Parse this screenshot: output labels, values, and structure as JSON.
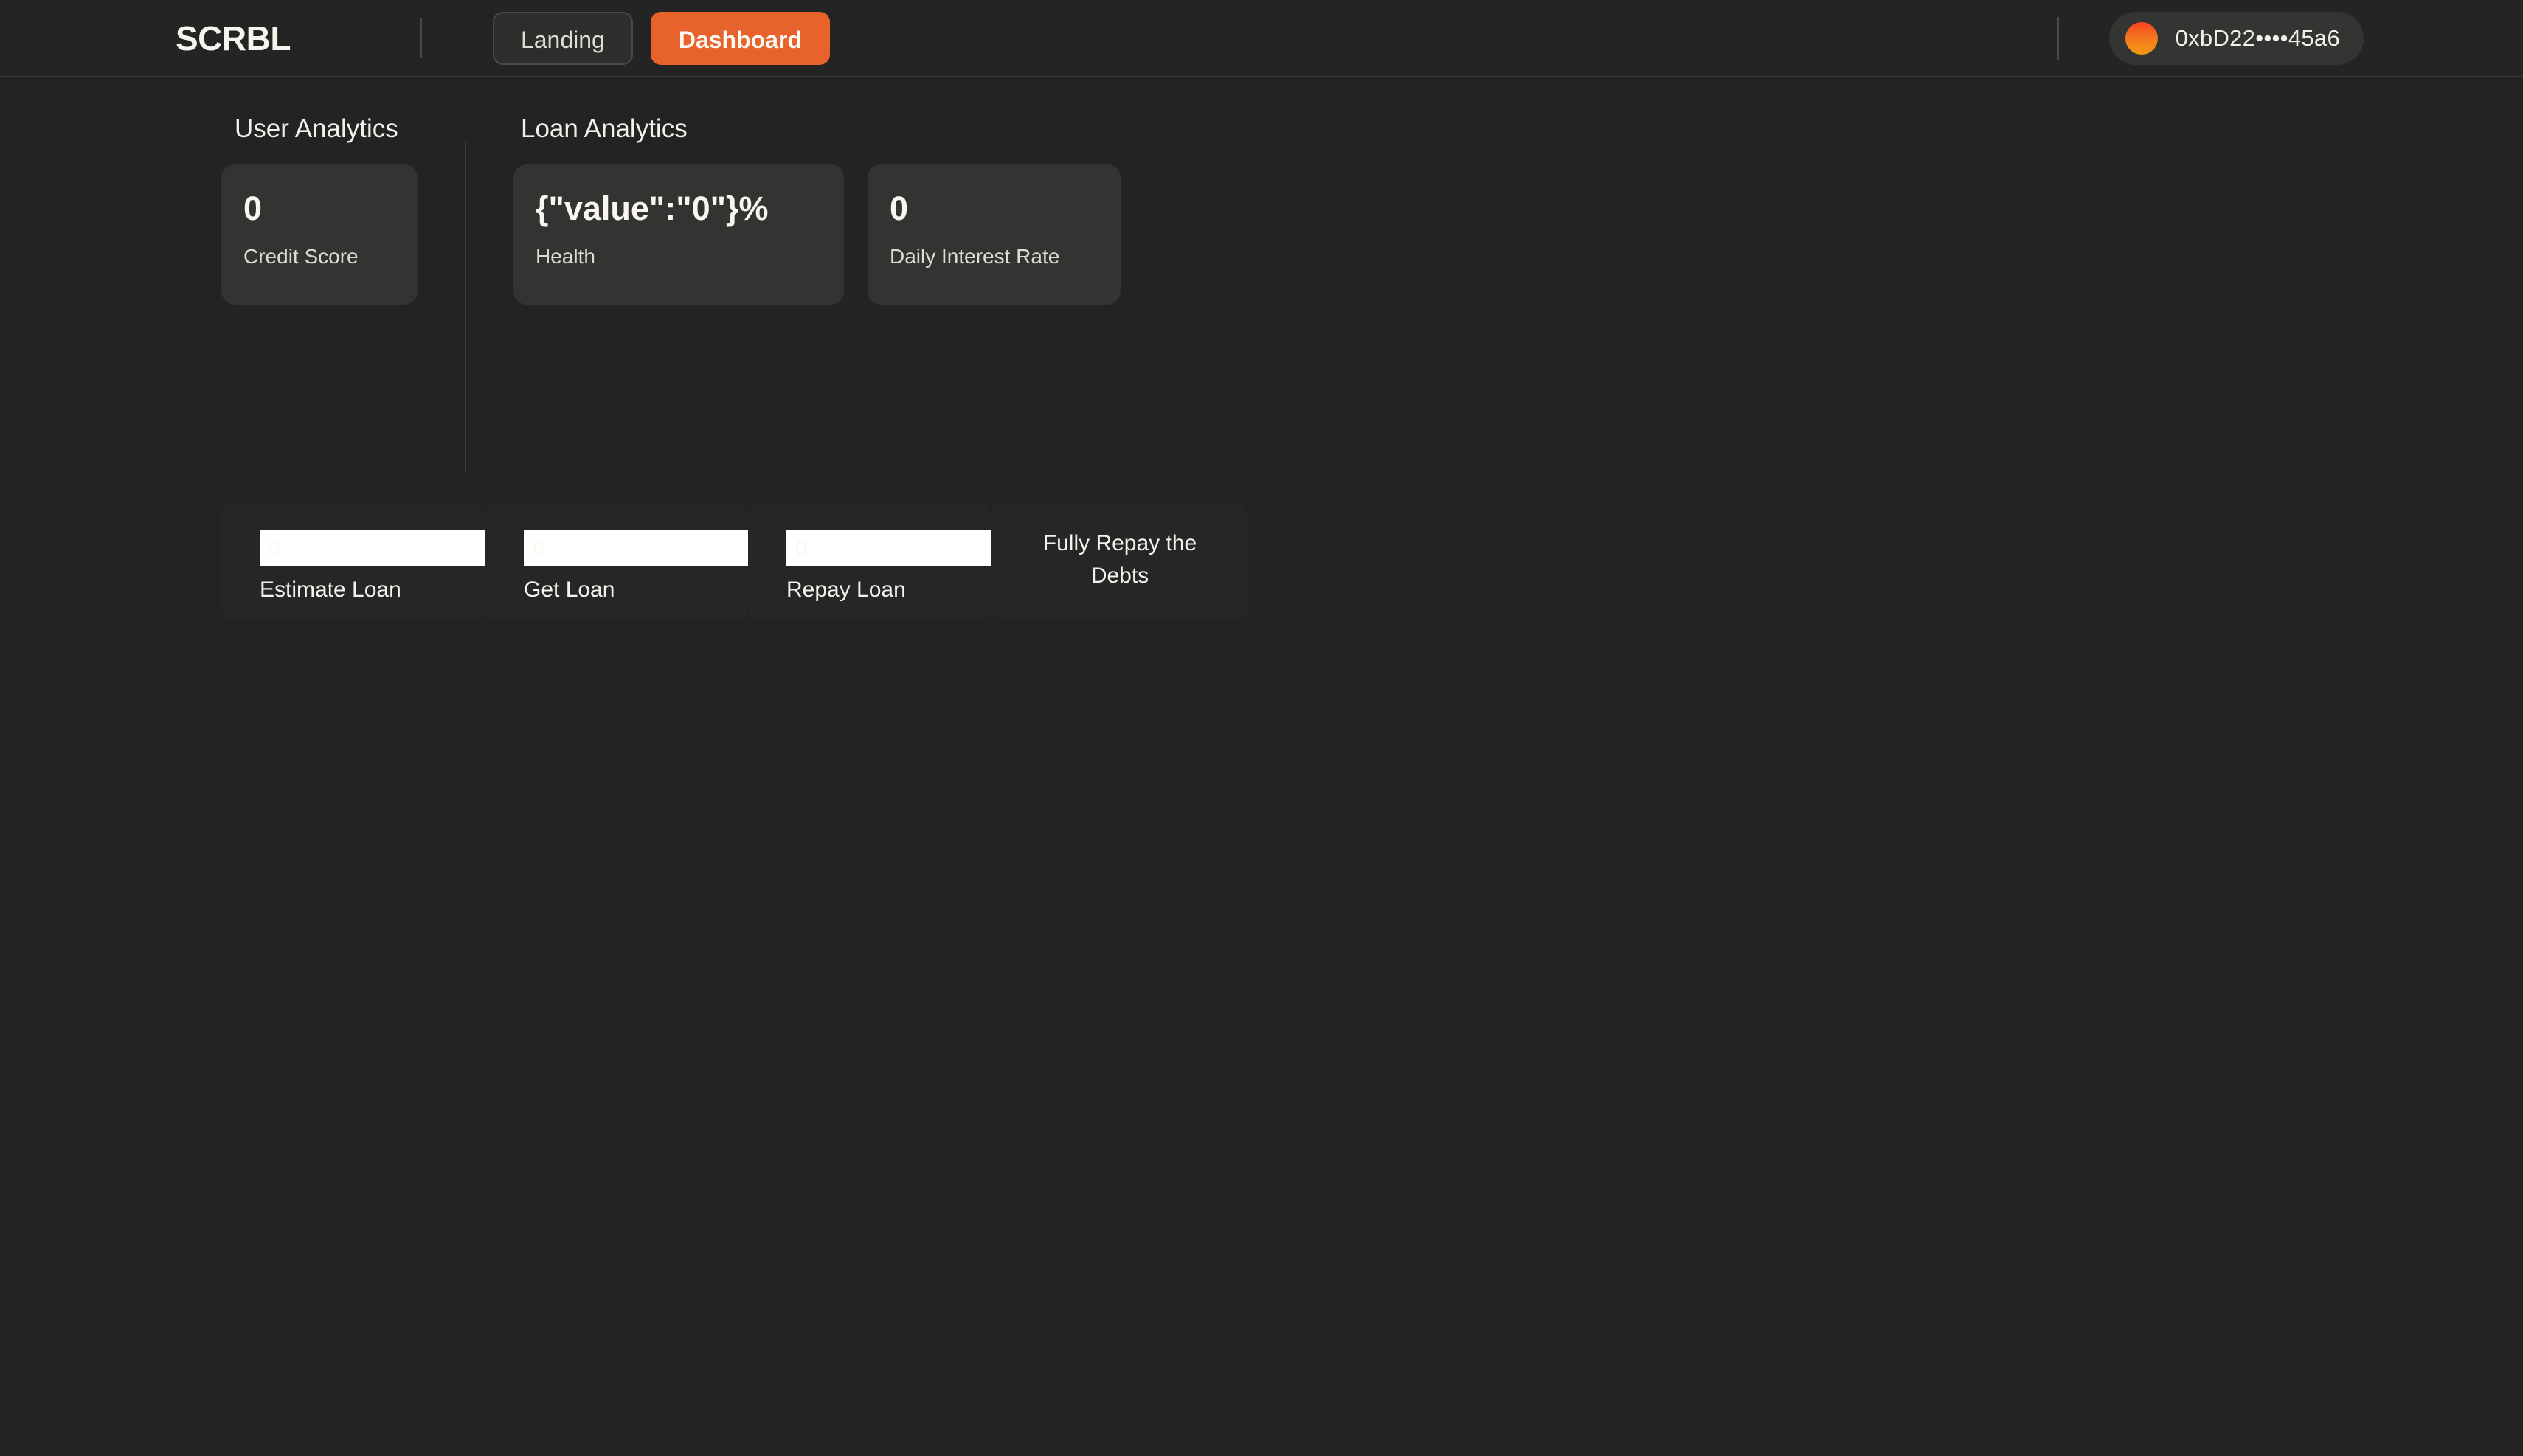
{
  "header": {
    "brand": "SCRBL",
    "nav": [
      {
        "label": "Landing",
        "active": false
      },
      {
        "label": "Dashboard",
        "active": true
      }
    ],
    "wallet": {
      "address": "0xbD22••••45a6",
      "avatar_icon": "wallet-avatar-gradient-circle",
      "avatar_gradient_from": "#f4431f",
      "avatar_gradient_to": "#f59a14"
    },
    "accent_color": "#e8622b",
    "background_color": "#242424"
  },
  "main": {
    "background_color": "#232323",
    "analytics": [
      {
        "title": "User Analytics",
        "cards": [
          {
            "value": "0",
            "label": "Credit Score"
          }
        ]
      },
      {
        "title": "Loan Analytics",
        "cards": [
          {
            "value": "{\"value\":\"0\"}%",
            "label": "Health"
          },
          {
            "value": "0",
            "label": "Daily Interest Rate"
          }
        ]
      }
    ],
    "actions": [
      {
        "label": "Estimate Loan",
        "input_placeholder": "0",
        "input_value": "",
        "has_input": true
      },
      {
        "label": "Get Loan",
        "input_placeholder": "0",
        "input_value": "",
        "has_input": true
      },
      {
        "label": "Repay Loan",
        "input_placeholder": "0",
        "input_value": "",
        "has_input": true
      },
      {
        "label": "Fully Repay the Debts",
        "has_input": false
      }
    ]
  }
}
